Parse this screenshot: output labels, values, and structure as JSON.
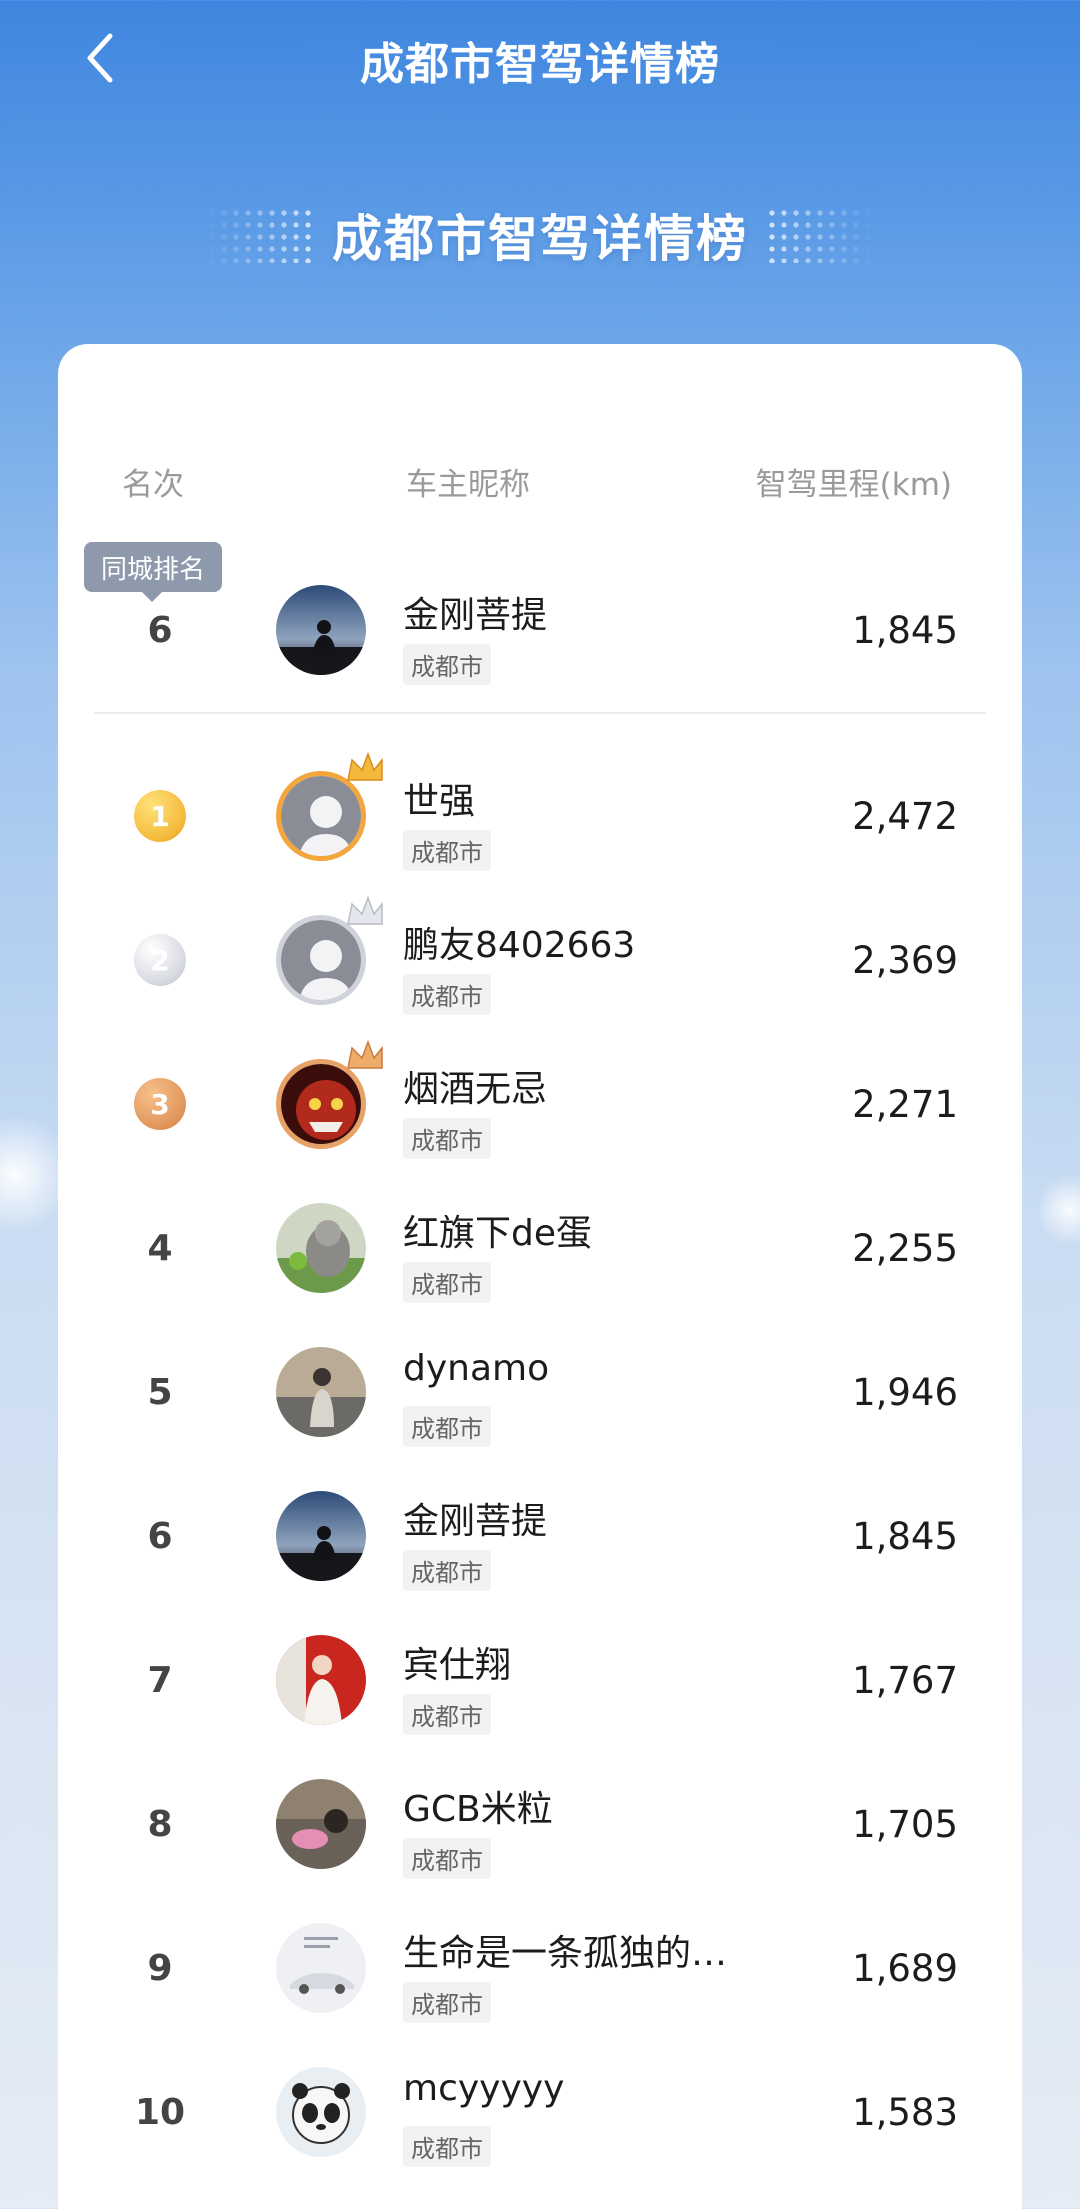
{
  "header": {
    "title": "成都市智驾详情榜"
  },
  "hero": {
    "title": "成都市智驾详情榜"
  },
  "table": {
    "col_rank": "名次",
    "col_name": "车主昵称",
    "col_distance": "智驾里程(km)"
  },
  "my_rank": {
    "tooltip": "同城排名",
    "rank": "6",
    "name": "金刚菩提",
    "city": "成都市",
    "distance": "1,845"
  },
  "rows": [
    {
      "rank": "1",
      "name": "世强",
      "city": "成都市",
      "distance": "2,472"
    },
    {
      "rank": "2",
      "name": "鹏友8402663",
      "city": "成都市",
      "distance": "2,369"
    },
    {
      "rank": "3",
      "name": "烟酒无忌",
      "city": "成都市",
      "distance": "2,271"
    },
    {
      "rank": "4",
      "name": "红旗下de蛋",
      "city": "成都市",
      "distance": "2,255"
    },
    {
      "rank": "5",
      "name": "dynamo",
      "city": "成都市",
      "distance": "1,946"
    },
    {
      "rank": "6",
      "name": "金刚菩提",
      "city": "成都市",
      "distance": "1,845"
    },
    {
      "rank": "7",
      "name": "宾仕翔",
      "city": "成都市",
      "distance": "1,767"
    },
    {
      "rank": "8",
      "name": "GCB米粒",
      "city": "成都市",
      "distance": "1,705"
    },
    {
      "rank": "9",
      "name": "生命是一条孤独的…",
      "city": "成都市",
      "distance": "1,689"
    },
    {
      "rank": "10",
      "name": "mcyyyyy",
      "city": "成都市",
      "distance": "1,583"
    }
  ],
  "colors": {
    "gold": "#f4b93a",
    "silver": "#c9ccd6",
    "bronze": "#e0955a",
    "accent_blue": "#3f86e0"
  }
}
